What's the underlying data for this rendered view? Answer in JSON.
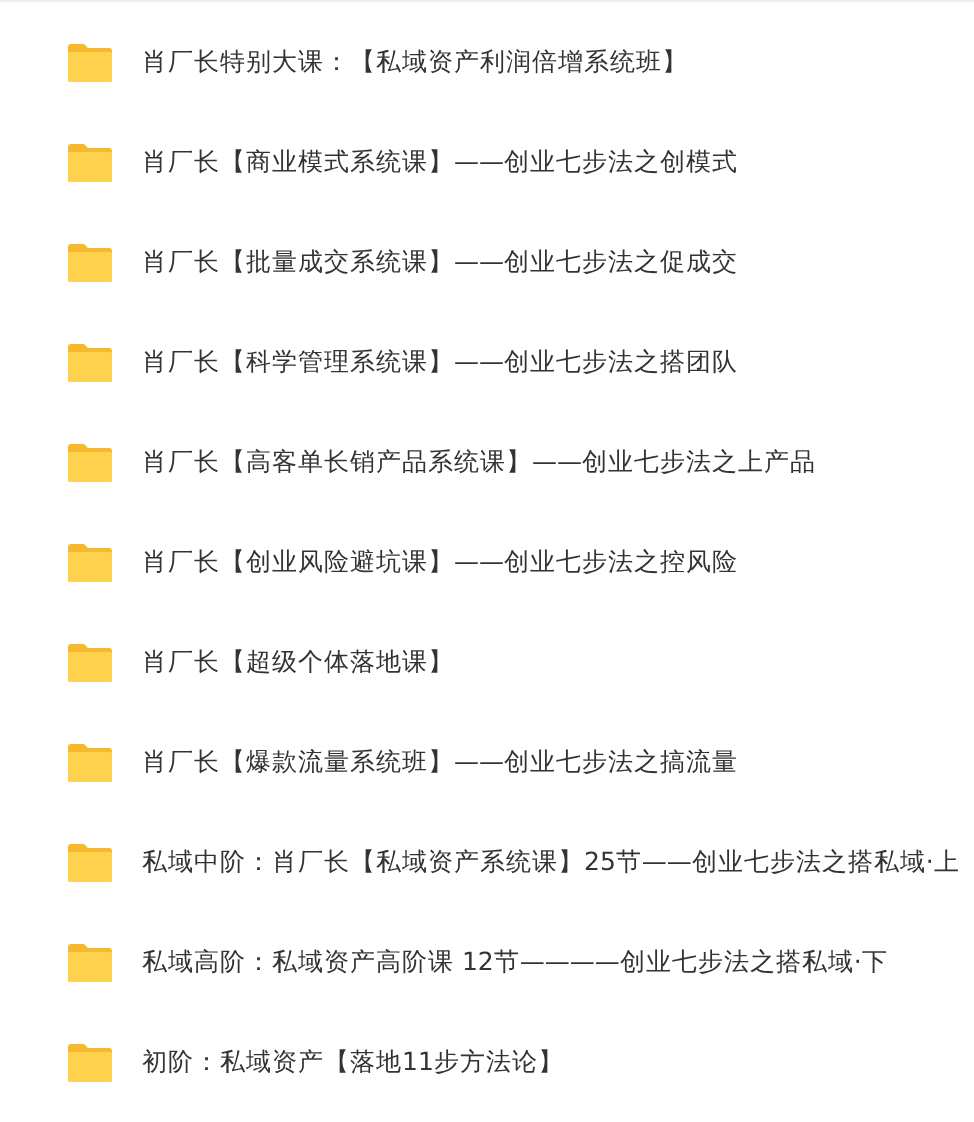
{
  "folders": [
    {
      "name": "肖厂长特别大课：【私域资产利润倍增系统班】"
    },
    {
      "name": "肖厂长【商业模式系统课】——创业七步法之创模式"
    },
    {
      "name": "肖厂长【批量成交系统课】——创业七步法之促成交"
    },
    {
      "name": "肖厂长【科学管理系统课】——创业七步法之搭团队"
    },
    {
      "name": "肖厂长【高客单长销产品系统课】——创业七步法之上产品"
    },
    {
      "name": "肖厂长【创业风险避坑课】——创业七步法之控风险"
    },
    {
      "name": "肖厂长【超级个体落地课】"
    },
    {
      "name": "肖厂长【爆款流量系统班】——创业七步法之搞流量"
    },
    {
      "name": "私域中阶：肖厂长【私域资产系统课】25节——创业七步法之搭私域·上"
    },
    {
      "name": "私域高阶：私域资产高阶课 12节————创业七步法之搭私域·下"
    },
    {
      "name": "初阶：私域资产【落地11步方法论】"
    }
  ]
}
